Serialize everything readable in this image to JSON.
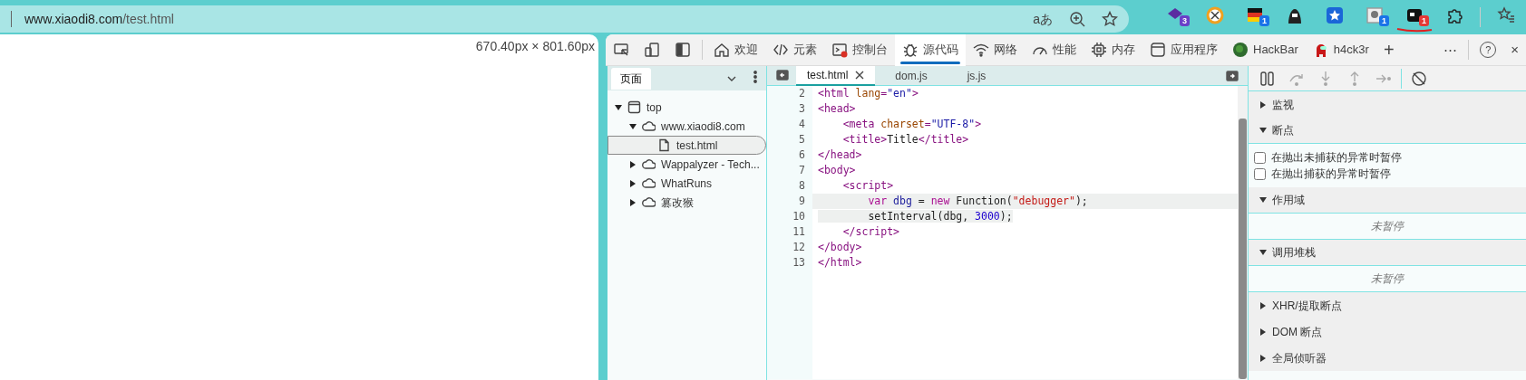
{
  "address_bar": {
    "host": "www.xiaodi8.com",
    "path": "/test.html",
    "read_aloud": "aあ"
  },
  "extensions": [
    {
      "kind": "stack",
      "badge": {
        "text": "3",
        "color": "#6a3fc8"
      },
      "underlined": false
    },
    {
      "kind": "ring",
      "underlined": false
    },
    {
      "kind": "flag",
      "badge": {
        "text": "1",
        "color": "#1a73e8"
      },
      "underlined": false
    },
    {
      "kind": "hood",
      "underlined": false
    },
    {
      "kind": "star",
      "underlined": false
    },
    {
      "kind": "photo",
      "badge": {
        "text": "1",
        "color": "#1a73e8"
      },
      "underlined": false
    },
    {
      "kind": "square",
      "badge": {
        "text": "1",
        "color": "#e53935"
      },
      "underlined": true
    },
    {
      "kind": "puzzle",
      "underlined": false
    },
    {
      "kind": "favorites",
      "underlined": false
    }
  ],
  "viewport_size": "670.40px × 801.60px",
  "devtools_tabs": [
    {
      "kind": "inspect",
      "selected": false
    },
    {
      "kind": "device",
      "selected": false
    },
    {
      "kind": "dock",
      "selected": false
    },
    {
      "kind": "home",
      "label": "欢迎",
      "selected": false
    },
    {
      "kind": "code",
      "label": "元素",
      "selected": false
    },
    {
      "kind": "console",
      "label": "控制台",
      "selected": false
    },
    {
      "kind": "bug",
      "label": "源代码",
      "selected": true
    },
    {
      "kind": "wifi",
      "label": "网络",
      "selected": false
    },
    {
      "kind": "gauge",
      "label": "性能",
      "selected": false
    },
    {
      "kind": "chip",
      "label": "内存",
      "selected": false
    },
    {
      "kind": "app",
      "label": "应用程序",
      "selected": false
    },
    {
      "kind": "hackbar",
      "label": "HackBar",
      "selected": false
    },
    {
      "kind": "figure",
      "label": "h4ck3r",
      "selected": false
    },
    {
      "kind": "add",
      "label": "+",
      "selected": false
    }
  ],
  "devtools_actions": [
    "⋯",
    "?",
    "×"
  ],
  "navigator": {
    "tab": "页面",
    "tree": [
      {
        "label": "top",
        "kind": "frame",
        "expanded": true,
        "selected": false,
        "children": [
          {
            "label": "www.xiaodi8.com",
            "kind": "cloud",
            "expanded": true,
            "selected": false,
            "children": [
              {
                "label": "test.html",
                "kind": "file",
                "selected": true
              }
            ]
          },
          {
            "label": "Wappalyzer - Tech...",
            "kind": "cloud",
            "expanded": false,
            "selected": false
          },
          {
            "label": "WhatRuns",
            "kind": "cloud",
            "expanded": false,
            "selected": false
          },
          {
            "label": "篡改猴",
            "kind": "cloud",
            "expanded": false,
            "selected": false
          }
        ]
      }
    ]
  },
  "editor": {
    "tabs": [
      {
        "label": "test.html",
        "selected": true,
        "closable": true
      },
      {
        "label": "dom.js",
        "selected": false,
        "closable": false
      },
      {
        "label": "js.js",
        "selected": false,
        "closable": false
      }
    ],
    "lines": [
      {
        "number": "2",
        "selected": false,
        "tokens": [
          {
            "text": "<html ",
            "kind": "tag"
          },
          {
            "text": "lang",
            "kind": "attr"
          },
          {
            "text": "=",
            "kind": "tag"
          },
          {
            "text": "\"en\"",
            "kind": "value"
          },
          {
            "text": ">",
            "kind": "tag"
          }
        ]
      },
      {
        "number": "3",
        "selected": false,
        "tokens": [
          {
            "text": "<head>",
            "kind": "tag"
          }
        ]
      },
      {
        "number": "4",
        "selected": false,
        "tokens": [
          {
            "text": "    <meta ",
            "kind": "tag"
          },
          {
            "text": "charset",
            "kind": "attr"
          },
          {
            "text": "=",
            "kind": "tag"
          },
          {
            "text": "\"UTF-8\"",
            "kind": "value"
          },
          {
            "text": ">",
            "kind": "tag"
          }
        ]
      },
      {
        "number": "5",
        "selected": false,
        "tokens": [
          {
            "text": "    <title>",
            "kind": "tag"
          },
          {
            "text": "Title",
            "kind": "plain"
          },
          {
            "text": "</title>",
            "kind": "tag"
          }
        ]
      },
      {
        "number": "6",
        "selected": false,
        "tokens": [
          {
            "text": "</head>",
            "kind": "tag"
          }
        ]
      },
      {
        "number": "7",
        "selected": false,
        "tokens": [
          {
            "text": "<body>",
            "kind": "tag"
          }
        ]
      },
      {
        "number": "8",
        "selected": false,
        "tokens": [
          {
            "text": "    <script>",
            "kind": "tag"
          }
        ]
      },
      {
        "number": "9",
        "selected": true,
        "tokens": [
          {
            "text": "        var ",
            "kind": "keyword"
          },
          {
            "text": "dbg",
            "kind": "variable"
          },
          {
            "text": " = ",
            "kind": "plain"
          },
          {
            "text": "new",
            "kind": "keyword"
          },
          {
            "text": " Function(",
            "kind": "plain"
          },
          {
            "text": "\"debugger\"",
            "kind": "string"
          },
          {
            "text": ");",
            "kind": "plain"
          }
        ]
      },
      {
        "number": "10",
        "selected": true,
        "tokens": [
          {
            "text": "        setInterval(dbg, ",
            "kind": "plain"
          },
          {
            "text": "3000",
            "kind": "number"
          },
          {
            "text": ");",
            "kind": "plain"
          }
        ]
      },
      {
        "number": "11",
        "selected": false,
        "tokens": [
          {
            "text": "    </script>",
            "kind": "tag"
          }
        ]
      },
      {
        "number": "12",
        "selected": false,
        "tokens": [
          {
            "text": "</body>",
            "kind": "tag"
          }
        ]
      },
      {
        "number": "13",
        "selected": false,
        "tokens": [
          {
            "text": "</html>",
            "kind": "tag"
          }
        ]
      }
    ]
  },
  "debugger": {
    "toolbar": [
      {
        "kind": "pause",
        "disabled": false
      },
      {
        "kind": "step-over",
        "disabled": true
      },
      {
        "kind": "step-into",
        "disabled": true
      },
      {
        "kind": "step-out",
        "disabled": true
      },
      {
        "kind": "step",
        "disabled": true
      },
      {
        "kind": "deactivate",
        "disabled": false
      }
    ],
    "sections": [
      {
        "title": "监视",
        "expanded": false
      },
      {
        "title": "断点",
        "expanded": true,
        "checkboxes": [
          {
            "label": "在抛出未捕获的异常时暂停",
            "checked": false
          },
          {
            "label": "在抛出捕获的异常时暂停",
            "checked": false
          }
        ]
      },
      {
        "title": "作用域",
        "expanded": true,
        "message": "未暂停"
      },
      {
        "title": "调用堆栈",
        "expanded": true,
        "message": "未暂停"
      },
      {
        "title": "XHR/提取断点",
        "expanded": false
      },
      {
        "title": "DOM 断点",
        "expanded": false
      },
      {
        "title": "全局侦听器",
        "expanded": false
      }
    ]
  }
}
